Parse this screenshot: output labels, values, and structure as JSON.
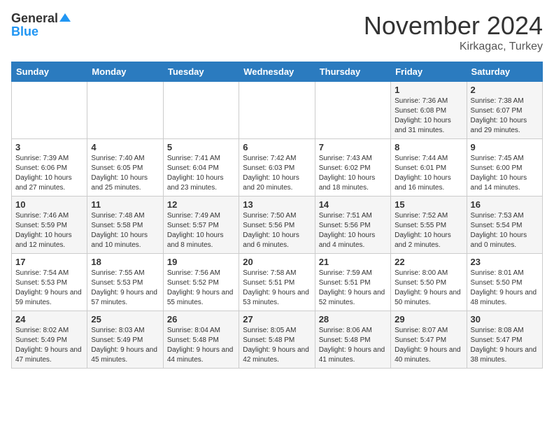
{
  "logo": {
    "general": "General",
    "blue": "Blue"
  },
  "title": "November 2024",
  "subtitle": "Kirkagac, Turkey",
  "days_of_week": [
    "Sunday",
    "Monday",
    "Tuesday",
    "Wednesday",
    "Thursday",
    "Friday",
    "Saturday"
  ],
  "weeks": [
    [
      {
        "day": "",
        "info": ""
      },
      {
        "day": "",
        "info": ""
      },
      {
        "day": "",
        "info": ""
      },
      {
        "day": "",
        "info": ""
      },
      {
        "day": "",
        "info": ""
      },
      {
        "day": "1",
        "info": "Sunrise: 7:36 AM\nSunset: 6:08 PM\nDaylight: 10 hours and 31 minutes."
      },
      {
        "day": "2",
        "info": "Sunrise: 7:38 AM\nSunset: 6:07 PM\nDaylight: 10 hours and 29 minutes."
      }
    ],
    [
      {
        "day": "3",
        "info": "Sunrise: 7:39 AM\nSunset: 6:06 PM\nDaylight: 10 hours and 27 minutes."
      },
      {
        "day": "4",
        "info": "Sunrise: 7:40 AM\nSunset: 6:05 PM\nDaylight: 10 hours and 25 minutes."
      },
      {
        "day": "5",
        "info": "Sunrise: 7:41 AM\nSunset: 6:04 PM\nDaylight: 10 hours and 23 minutes."
      },
      {
        "day": "6",
        "info": "Sunrise: 7:42 AM\nSunset: 6:03 PM\nDaylight: 10 hours and 20 minutes."
      },
      {
        "day": "7",
        "info": "Sunrise: 7:43 AM\nSunset: 6:02 PM\nDaylight: 10 hours and 18 minutes."
      },
      {
        "day": "8",
        "info": "Sunrise: 7:44 AM\nSunset: 6:01 PM\nDaylight: 10 hours and 16 minutes."
      },
      {
        "day": "9",
        "info": "Sunrise: 7:45 AM\nSunset: 6:00 PM\nDaylight: 10 hours and 14 minutes."
      }
    ],
    [
      {
        "day": "10",
        "info": "Sunrise: 7:46 AM\nSunset: 5:59 PM\nDaylight: 10 hours and 12 minutes."
      },
      {
        "day": "11",
        "info": "Sunrise: 7:48 AM\nSunset: 5:58 PM\nDaylight: 10 hours and 10 minutes."
      },
      {
        "day": "12",
        "info": "Sunrise: 7:49 AM\nSunset: 5:57 PM\nDaylight: 10 hours and 8 minutes."
      },
      {
        "day": "13",
        "info": "Sunrise: 7:50 AM\nSunset: 5:56 PM\nDaylight: 10 hours and 6 minutes."
      },
      {
        "day": "14",
        "info": "Sunrise: 7:51 AM\nSunset: 5:56 PM\nDaylight: 10 hours and 4 minutes."
      },
      {
        "day": "15",
        "info": "Sunrise: 7:52 AM\nSunset: 5:55 PM\nDaylight: 10 hours and 2 minutes."
      },
      {
        "day": "16",
        "info": "Sunrise: 7:53 AM\nSunset: 5:54 PM\nDaylight: 10 hours and 0 minutes."
      }
    ],
    [
      {
        "day": "17",
        "info": "Sunrise: 7:54 AM\nSunset: 5:53 PM\nDaylight: 9 hours and 59 minutes."
      },
      {
        "day": "18",
        "info": "Sunrise: 7:55 AM\nSunset: 5:53 PM\nDaylight: 9 hours and 57 minutes."
      },
      {
        "day": "19",
        "info": "Sunrise: 7:56 AM\nSunset: 5:52 PM\nDaylight: 9 hours and 55 minutes."
      },
      {
        "day": "20",
        "info": "Sunrise: 7:58 AM\nSunset: 5:51 PM\nDaylight: 9 hours and 53 minutes."
      },
      {
        "day": "21",
        "info": "Sunrise: 7:59 AM\nSunset: 5:51 PM\nDaylight: 9 hours and 52 minutes."
      },
      {
        "day": "22",
        "info": "Sunrise: 8:00 AM\nSunset: 5:50 PM\nDaylight: 9 hours and 50 minutes."
      },
      {
        "day": "23",
        "info": "Sunrise: 8:01 AM\nSunset: 5:50 PM\nDaylight: 9 hours and 48 minutes."
      }
    ],
    [
      {
        "day": "24",
        "info": "Sunrise: 8:02 AM\nSunset: 5:49 PM\nDaylight: 9 hours and 47 minutes."
      },
      {
        "day": "25",
        "info": "Sunrise: 8:03 AM\nSunset: 5:49 PM\nDaylight: 9 hours and 45 minutes."
      },
      {
        "day": "26",
        "info": "Sunrise: 8:04 AM\nSunset: 5:48 PM\nDaylight: 9 hours and 44 minutes."
      },
      {
        "day": "27",
        "info": "Sunrise: 8:05 AM\nSunset: 5:48 PM\nDaylight: 9 hours and 42 minutes."
      },
      {
        "day": "28",
        "info": "Sunrise: 8:06 AM\nSunset: 5:48 PM\nDaylight: 9 hours and 41 minutes."
      },
      {
        "day": "29",
        "info": "Sunrise: 8:07 AM\nSunset: 5:47 PM\nDaylight: 9 hours and 40 minutes."
      },
      {
        "day": "30",
        "info": "Sunrise: 8:08 AM\nSunset: 5:47 PM\nDaylight: 9 hours and 38 minutes."
      }
    ]
  ]
}
